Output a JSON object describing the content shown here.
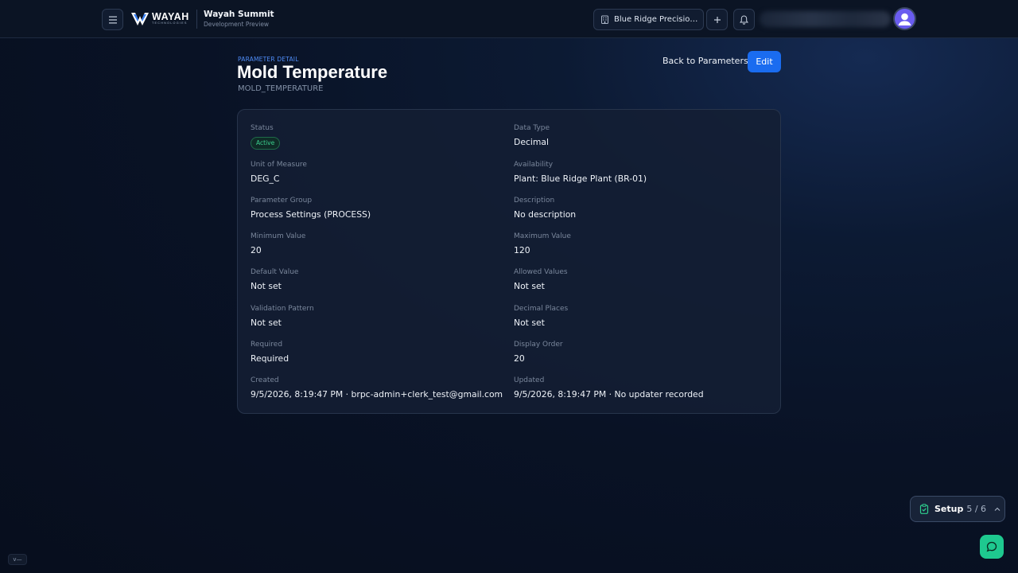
{
  "header": {
    "logo_word": "WAYAH",
    "logo_sub": "TECHNOLOGIES",
    "app_name": "Wayah Summit",
    "app_subtitle": "Development Preview",
    "org_name": "Blue Ridge Precision C...",
    "icons": {
      "menu": "menu-icon",
      "org": "building-icon",
      "add": "plus-icon",
      "notifications": "bell-icon",
      "avatar": "user-icon"
    }
  },
  "page": {
    "eyebrow": "PARAMETER DETAIL",
    "title": "Mold Temperature",
    "code": "MOLD_TEMPERATURE",
    "back_label": "Back to Parameters",
    "edit_label": "Edit"
  },
  "details": {
    "status": {
      "label": "Status",
      "value": "Active"
    },
    "data_type": {
      "label": "Data Type",
      "value": "Decimal"
    },
    "unit": {
      "label": "Unit of Measure",
      "value": "DEG_C"
    },
    "availability": {
      "label": "Availability",
      "value": "Plant: Blue Ridge Plant (BR-01)"
    },
    "group": {
      "label": "Parameter Group",
      "value": "Process Settings (PROCESS)"
    },
    "description": {
      "label": "Description",
      "value": "No description"
    },
    "min": {
      "label": "Minimum Value",
      "value": "20"
    },
    "max": {
      "label": "Maximum Value",
      "value": "120"
    },
    "default": {
      "label": "Default Value",
      "value": "Not set"
    },
    "allowed": {
      "label": "Allowed Values",
      "value": "Not set"
    },
    "validation": {
      "label": "Validation Pattern",
      "value": "Not set"
    },
    "decimals": {
      "label": "Decimal Places",
      "value": "Not set"
    },
    "required": {
      "label": "Required",
      "value": "Required"
    },
    "display_order": {
      "label": "Display Order",
      "value": "20"
    },
    "created": {
      "label": "Created",
      "value": "9/5/2026, 8:19:47 PM · brpc-admin+clerk_test@gmail.com"
    },
    "updated": {
      "label": "Updated",
      "value": "9/5/2026, 8:19:47 PM · No updater recorded"
    }
  },
  "setup": {
    "label": "Setup",
    "count": "5 / 6",
    "icon": "clipboard-check-icon"
  },
  "chat": {
    "icon": "chat-bubble-icon"
  },
  "version": {
    "label": "v—"
  },
  "colors": {
    "accent": "#1a6cf0",
    "status_green": "#3ccf8e",
    "chat_green": "#1ec98f",
    "background": "#091225"
  }
}
